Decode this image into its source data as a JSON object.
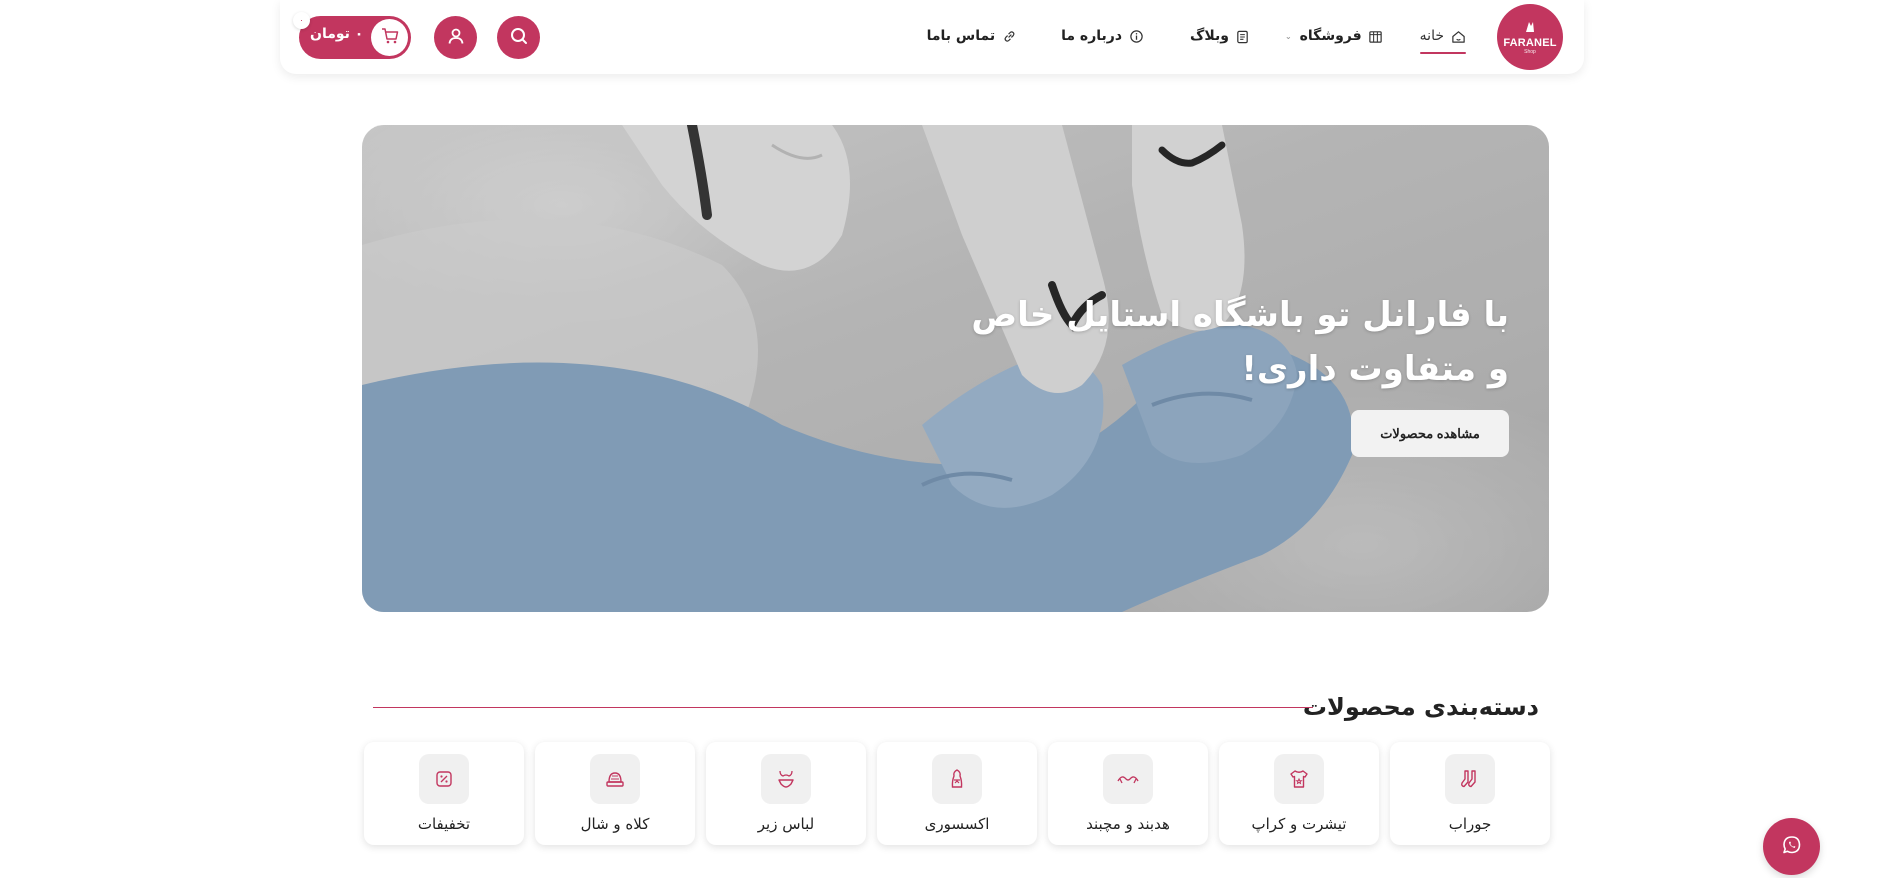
{
  "brand": {
    "name": "FARANEL",
    "sub": "Shop",
    "accent": "#c2365f"
  },
  "nav": {
    "items": [
      {
        "label": "خانه",
        "icon": "home-icon",
        "active": true
      },
      {
        "label": "فروشگاه",
        "icon": "shop-icon",
        "has_dropdown": true
      },
      {
        "label": "وبلاگ",
        "icon": "blog-icon"
      },
      {
        "label": "درباره ما",
        "icon": "info-icon"
      },
      {
        "label": "تماس باما",
        "icon": "link-icon"
      }
    ]
  },
  "header_actions": {
    "search_icon": "search-icon",
    "account_icon": "user-icon",
    "cart": {
      "total": "۰ تومان",
      "count": "۰",
      "icon": "cart-icon"
    }
  },
  "hero": {
    "title": "با فارانل تو باشگاه استایل خاص و متفاوت داری!",
    "button_label": "مشاهده محصولات"
  },
  "categories": {
    "title": "دسته‌بندی محصولات",
    "items": [
      {
        "label": "جوراب",
        "icon": "socks-icon"
      },
      {
        "label": "تیشرت و کراپ",
        "icon": "tshirt-icon"
      },
      {
        "label": "هدبند و مچبند",
        "icon": "headband-icon"
      },
      {
        "label": "اکسسوری",
        "icon": "accessory-icon"
      },
      {
        "label": "لباس زیر",
        "icon": "underwear-icon"
      },
      {
        "label": "کلاه و شال",
        "icon": "hat-icon"
      },
      {
        "label": "تخفیفات",
        "icon": "discount-icon"
      }
    ]
  },
  "floating": {
    "whatsapp_icon": "whatsapp-icon"
  }
}
